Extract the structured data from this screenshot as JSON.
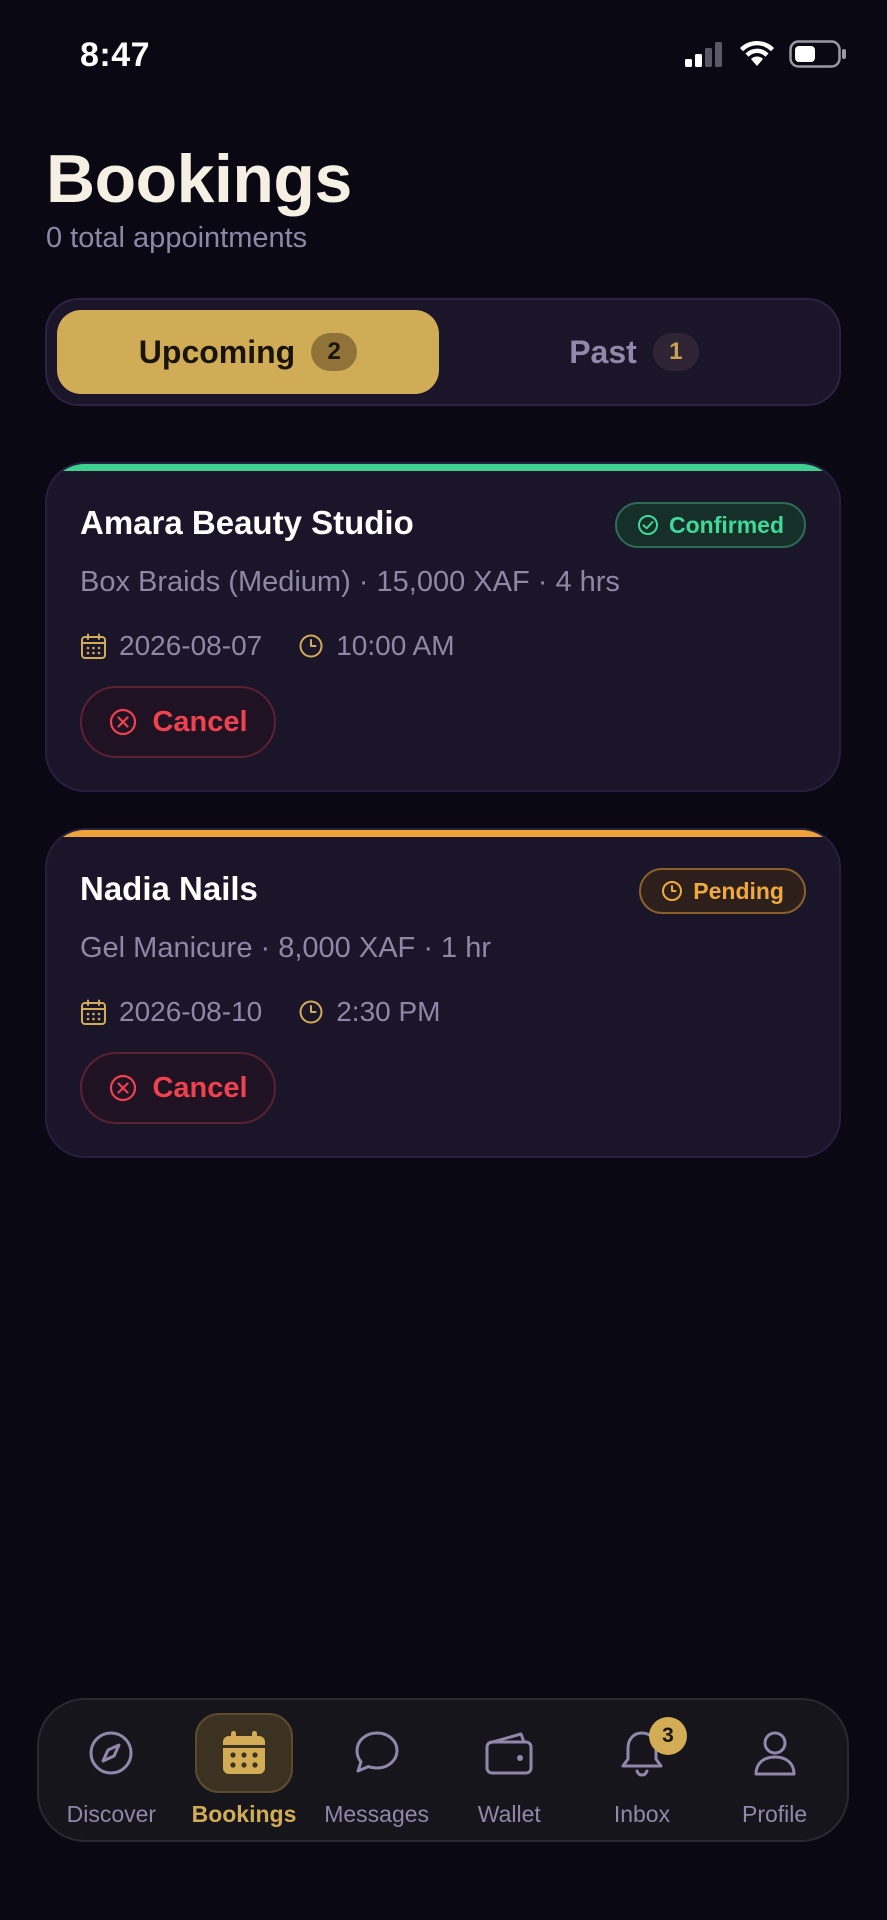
{
  "status_bar": {
    "time": "8:47"
  },
  "header": {
    "title": "Bookings",
    "subtitle": "0 total appointments"
  },
  "tabs": [
    {
      "label": "Upcoming",
      "count": "2",
      "active": true
    },
    {
      "label": "Past",
      "count": "1",
      "active": false
    }
  ],
  "bookings": [
    {
      "provider": "Amara Beauty Studio",
      "status": "Confirmed",
      "accent_color": "#3fcf8e",
      "service": "Box Braids (Medium) · 15,000 XAF · 4 hrs",
      "date": "2026-08-07",
      "time": "10:00 AM",
      "cancel_label": "Cancel"
    },
    {
      "provider": "Nadia Nails",
      "status": "Pending",
      "accent_color": "#f0a23a",
      "service": "Gel Manicure · 8,000 XAF · 1 hr",
      "date": "2026-08-10",
      "time": "2:30 PM",
      "cancel_label": "Cancel"
    }
  ],
  "nav": {
    "items": [
      {
        "label": "Discover",
        "icon": "compass-icon"
      },
      {
        "label": "Bookings",
        "icon": "calendar-icon",
        "active": true
      },
      {
        "label": "Messages",
        "icon": "chat-bubble-icon"
      },
      {
        "label": "Wallet",
        "icon": "wallet-icon"
      },
      {
        "label": "Inbox",
        "icon": "bell-icon",
        "badge": "3"
      },
      {
        "label": "Profile",
        "icon": "person-icon"
      }
    ]
  },
  "colors": {
    "accent": "#d0ac57",
    "background": "#0a0812",
    "danger": "#f0424e"
  }
}
